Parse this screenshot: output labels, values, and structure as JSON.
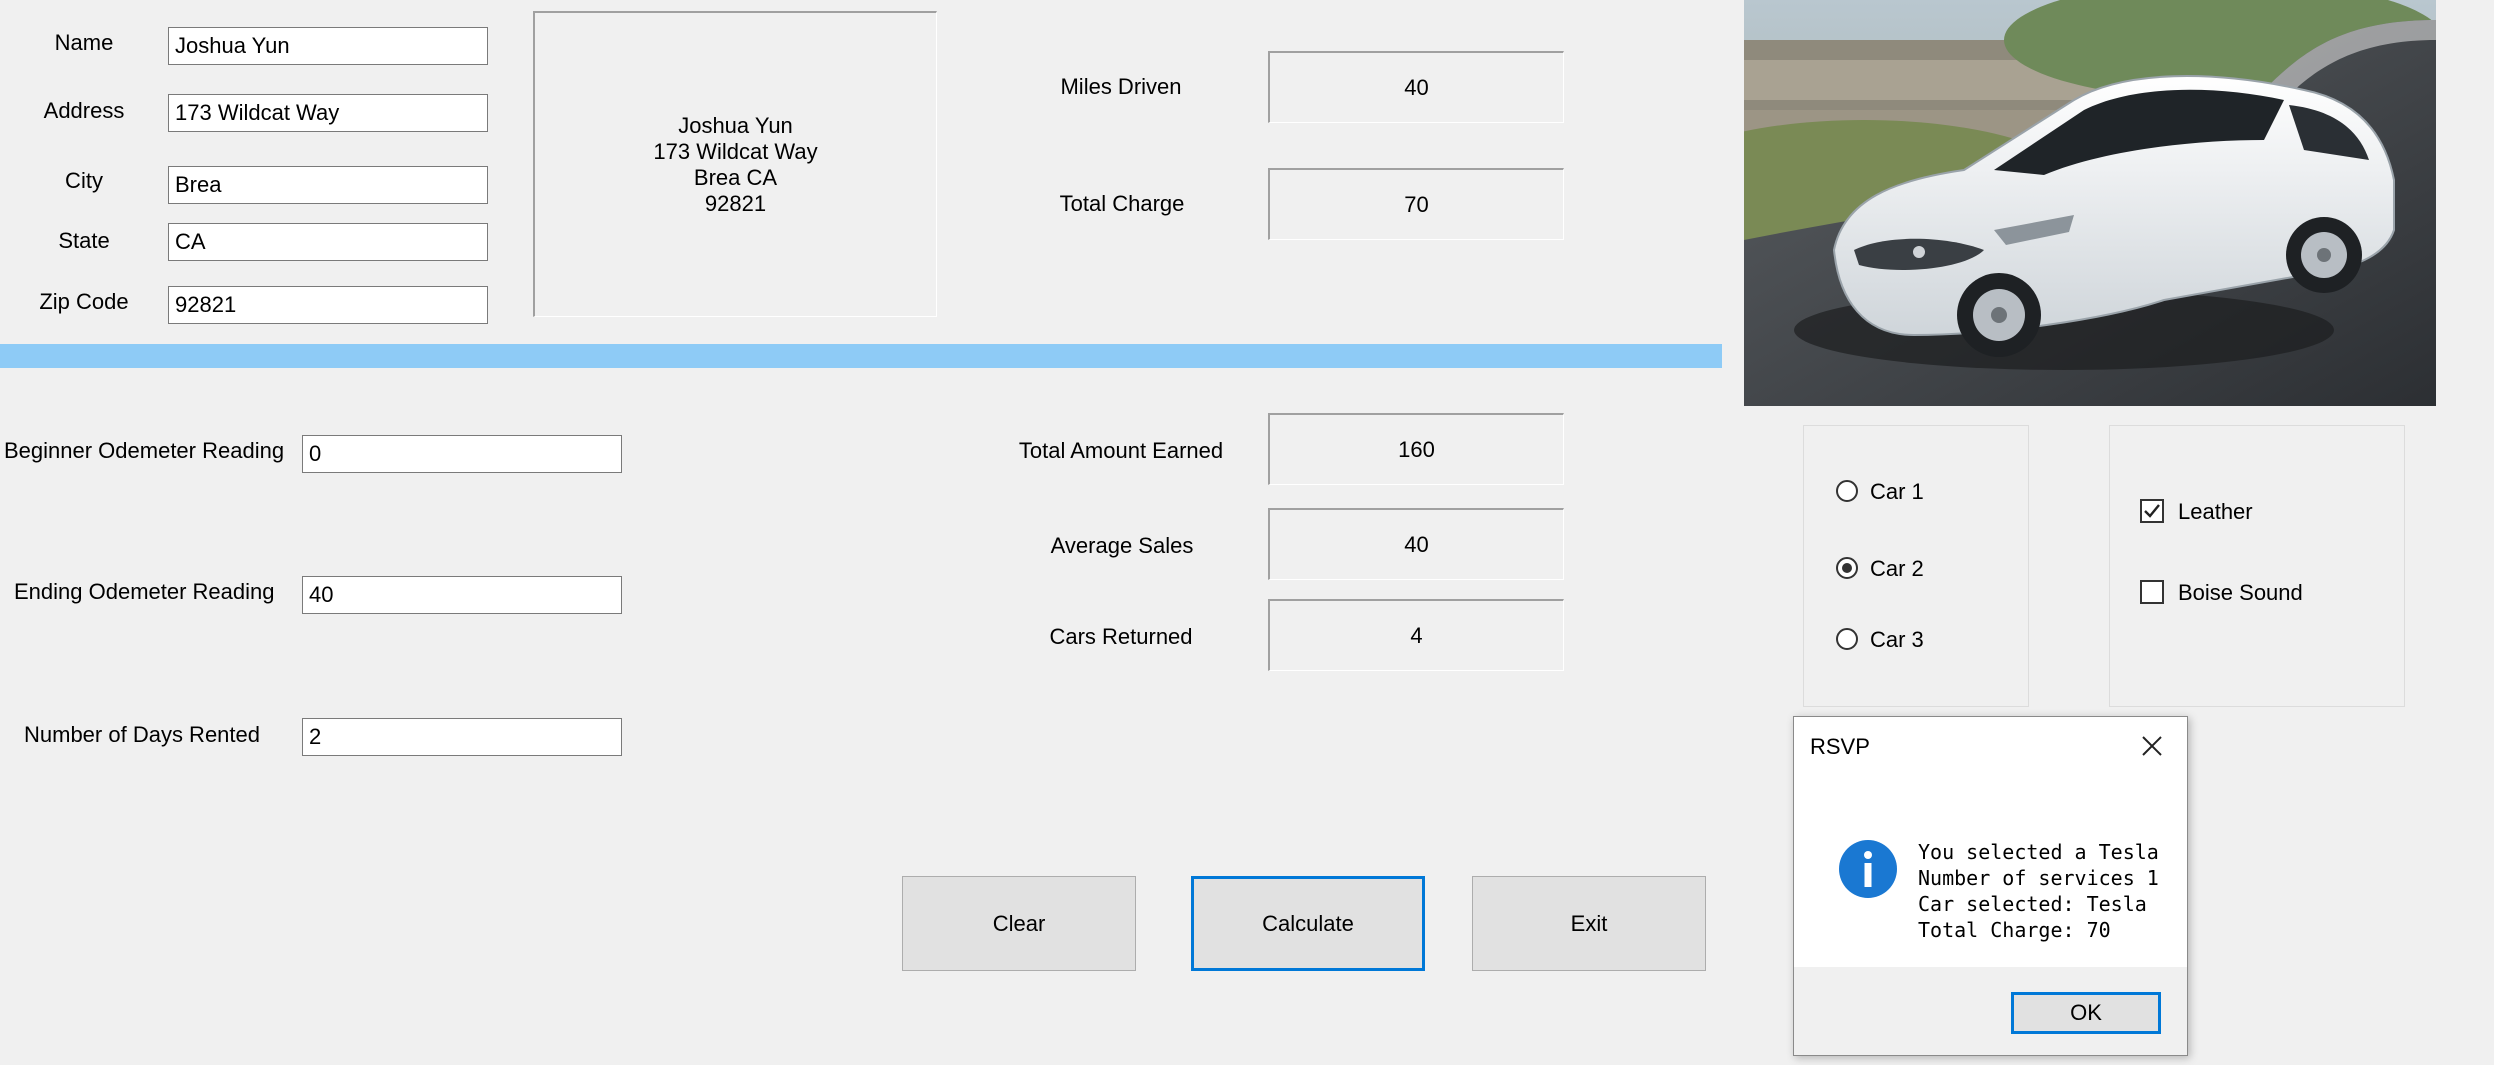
{
  "customer": {
    "name_label": "Name",
    "address_label": "Address",
    "city_label": "City",
    "state_label": "State",
    "zip_label": "Zip Code",
    "name": "Joshua Yun",
    "address": "173 Wildcat Way",
    "city": "Brea",
    "state": "CA",
    "zip": "92821"
  },
  "address_preview": {
    "line1": "Joshua Yun",
    "line2": "173 Wildcat Way",
    "line3": "Brea CA",
    "line4": "92821"
  },
  "summary_top": {
    "miles_label": "Miles Driven",
    "miles_value": "40",
    "charge_label": "Total Charge",
    "charge_value": "70"
  },
  "odometer": {
    "begin_label": "Beginner Odemeter Reading",
    "begin_value": "0",
    "end_label": "Ending Odemeter Reading",
    "end_value": "40",
    "days_label": "Number of Days Rented",
    "days_value": "2"
  },
  "summary_bottom": {
    "earned_label": "Total Amount Earned",
    "earned_value": "160",
    "average_label": "Average Sales",
    "average_value": "40",
    "returned_label": "Cars Returned",
    "returned_value": "4"
  },
  "cars": {
    "options": [
      "Car 1",
      "Car 2",
      "Car 3"
    ],
    "selected_index": 1
  },
  "extras": {
    "leather_label": "Leather",
    "leather_checked": true,
    "sound_label": "Boise Sound",
    "sound_checked": false
  },
  "buttons": {
    "clear": "Clear",
    "calculate": "Calculate",
    "exit": "Exit"
  },
  "dialog": {
    "title": "RSVP",
    "line1": "You selected a Tesla",
    "line2": "Number of services 1",
    "line3": "Car selected: Tesla",
    "line4": "Total Charge: 70",
    "ok": "OK"
  },
  "colors": {
    "separator": "#8ecbf6",
    "focus_accent": "#0078d7",
    "info_icon": "#1a78d2"
  }
}
